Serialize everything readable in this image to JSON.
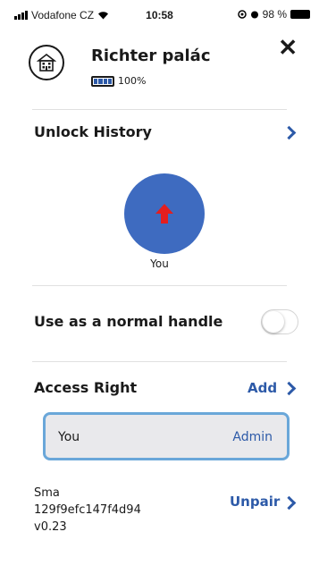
{
  "status_bar": {
    "carrier": "Vodafone CZ",
    "time": "10:58",
    "battery": "98 %"
  },
  "header": {
    "title": "Richter palác",
    "battery_level": "100%"
  },
  "unlock_history": {
    "title": "Unlock History",
    "last_user": "You"
  },
  "normal_handle": {
    "label": "Use as a normal handle",
    "enabled": false
  },
  "access_right": {
    "title": "Access Right",
    "add_label": "Add",
    "entries": [
      {
        "name": "You",
        "role": "Admin"
      }
    ]
  },
  "device": {
    "name": "Sma",
    "id": "129f9efc147f4d94",
    "version": "v0.23",
    "unpair_label": "Unpair"
  },
  "colors": {
    "accent": "#2d5aa8",
    "unlock_button": "#3e6bc0",
    "arrow": "#e41e1e",
    "selected_border": "#6aa7d9"
  }
}
